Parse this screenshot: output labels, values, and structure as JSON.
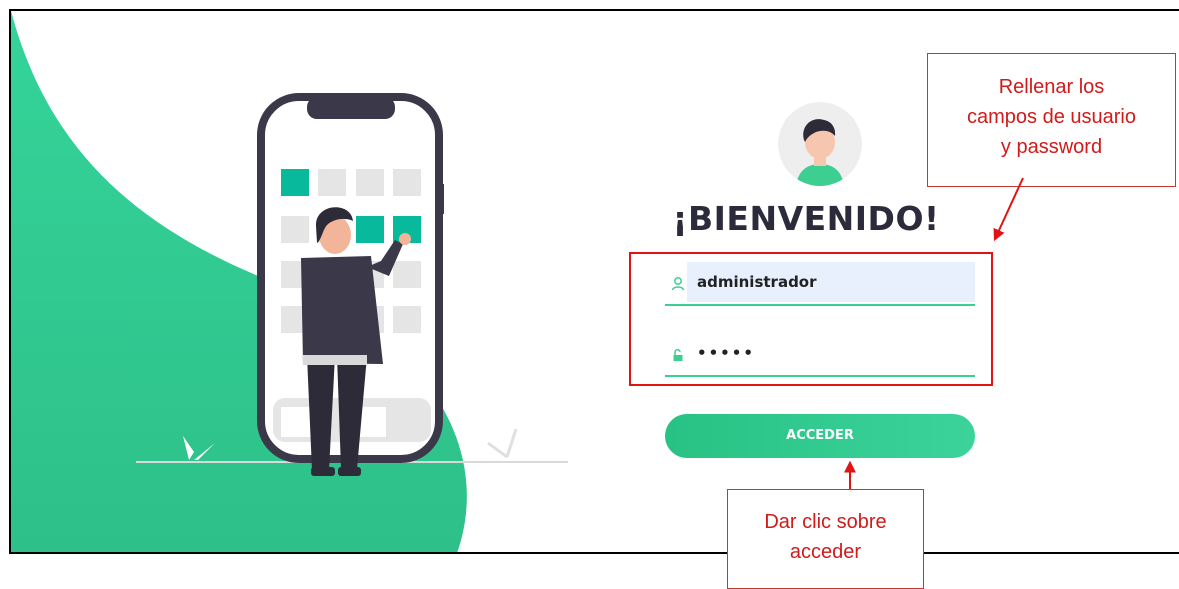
{
  "login": {
    "welcome_title": "¡BIENVENIDO!",
    "username_value": "administrador",
    "password_value": "•••••",
    "submit_label": "ACCEDER"
  },
  "annotations": {
    "fields_callout_lines": [
      "Rellenar los",
      "campos de usuario",
      "y password"
    ],
    "button_callout_lines": [
      "Dar clic sobre",
      "acceder"
    ]
  },
  "colors": {
    "brand_green": "#32d396",
    "accent_teal": "#00b894",
    "annotation_red": "#e31313",
    "autofill_blue": "#e8f0fe"
  },
  "icons": {
    "username": "user-icon",
    "password": "lock-icon",
    "avatar": "avatar-icon"
  }
}
